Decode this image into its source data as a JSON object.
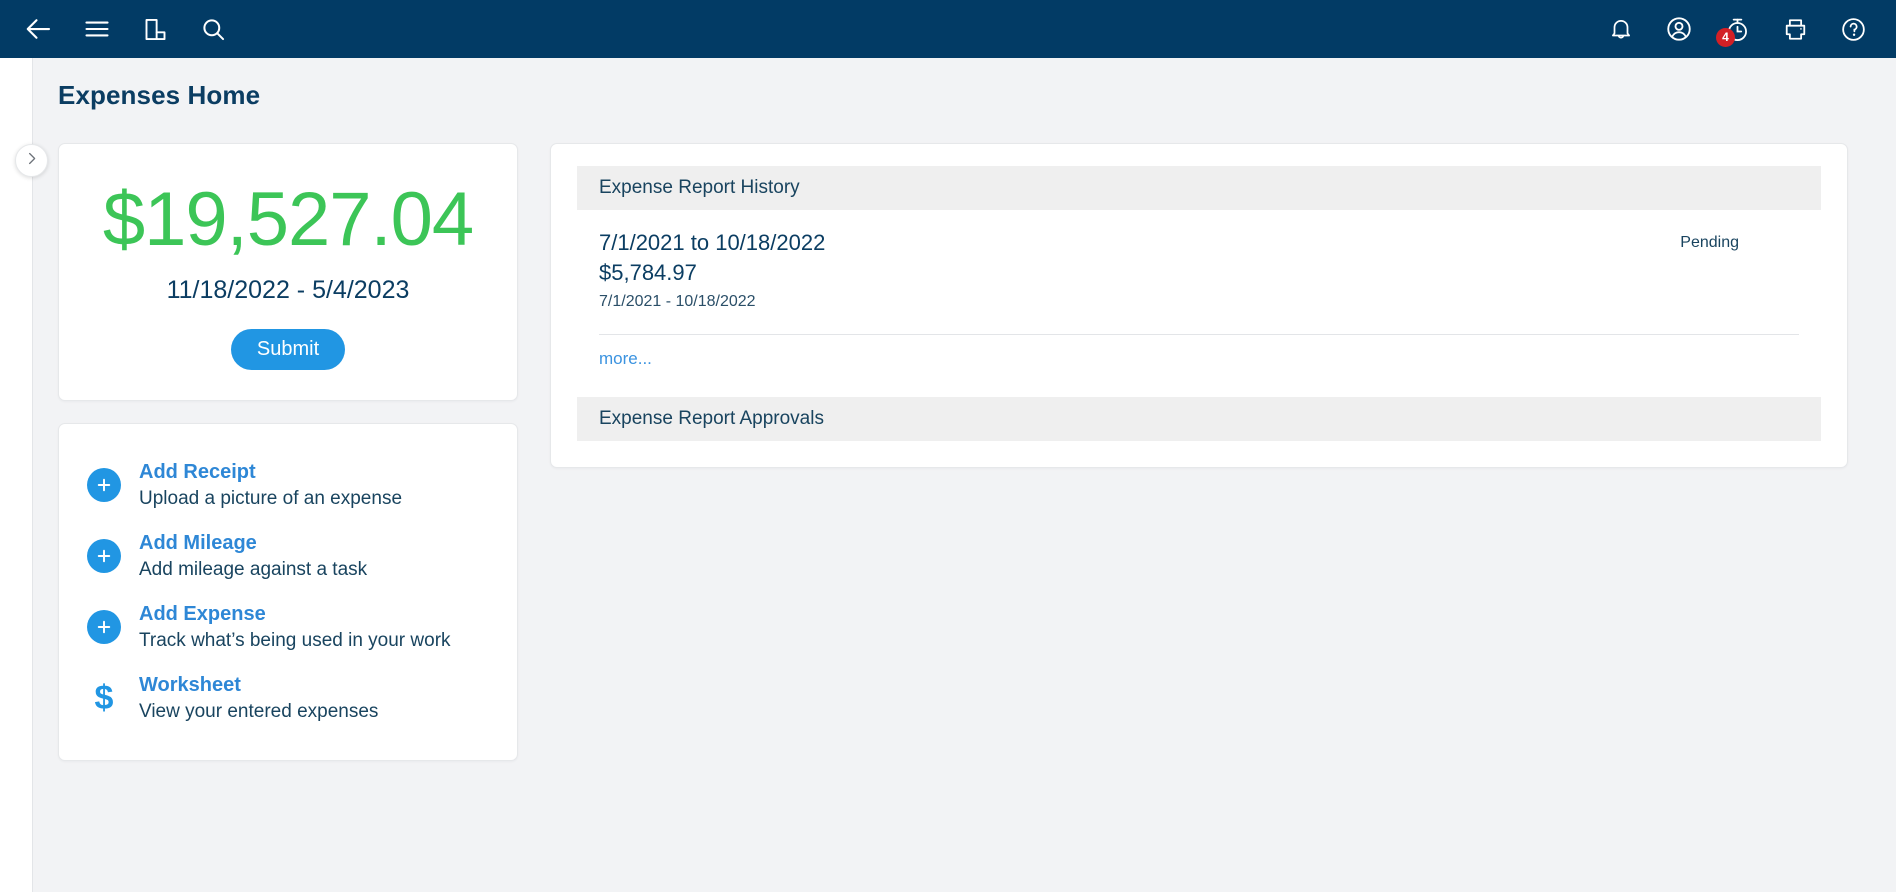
{
  "colors": {
    "appbar_bg": "#023b65",
    "page_bg": "#f2f3f5",
    "accent_blue": "#2196e3",
    "amount_green": "#3cc557",
    "title_navy": "#0b3d62",
    "badge_red": "#d32026"
  },
  "appbar": {
    "left_icons": [
      {
        "name": "back-arrow-icon",
        "label": "Back"
      },
      {
        "name": "hamburger-menu-icon",
        "label": "Menu"
      },
      {
        "name": "reports-chart-icon",
        "label": "Reports"
      },
      {
        "name": "search-icon",
        "label": "Search"
      }
    ],
    "right_icons": [
      {
        "name": "notifications-bell-icon",
        "label": "Notifications"
      },
      {
        "name": "account-user-icon",
        "label": "Account"
      },
      {
        "name": "timer-stopwatch-icon",
        "label": "Time Entry",
        "badge": "4"
      },
      {
        "name": "printer-icon",
        "label": "Print"
      },
      {
        "name": "help-question-icon",
        "label": "Help"
      }
    ]
  },
  "page": {
    "title": "Expenses Home",
    "rail_toggle_icon": "chevron-right-icon"
  },
  "summary": {
    "amount": "$19,527.04",
    "date_range": "11/18/2022 - 5/4/2023",
    "submit_label": "Submit"
  },
  "actions": [
    {
      "icon": "plus-circle-icon",
      "title": "Add Receipt",
      "subtitle": "Upload a picture of an expense"
    },
    {
      "icon": "plus-circle-icon",
      "title": "Add Mileage",
      "subtitle": "Add mileage against a task"
    },
    {
      "icon": "plus-circle-icon",
      "title": "Add Expense",
      "subtitle": "Track what’s being used in your work"
    },
    {
      "icon": "dollar-sign-icon",
      "title": "Worksheet",
      "subtitle": "View your entered expenses"
    }
  ],
  "history": {
    "heading": "Expense Report History",
    "rows": [
      {
        "range": "7/1/2021 to 10/18/2022",
        "amount": "$5,784.97",
        "sub_range": "7/1/2021 - 10/18/2022",
        "status": "Pending"
      }
    ],
    "more_label": "more..."
  },
  "approvals": {
    "heading": "Expense Report Approvals"
  }
}
